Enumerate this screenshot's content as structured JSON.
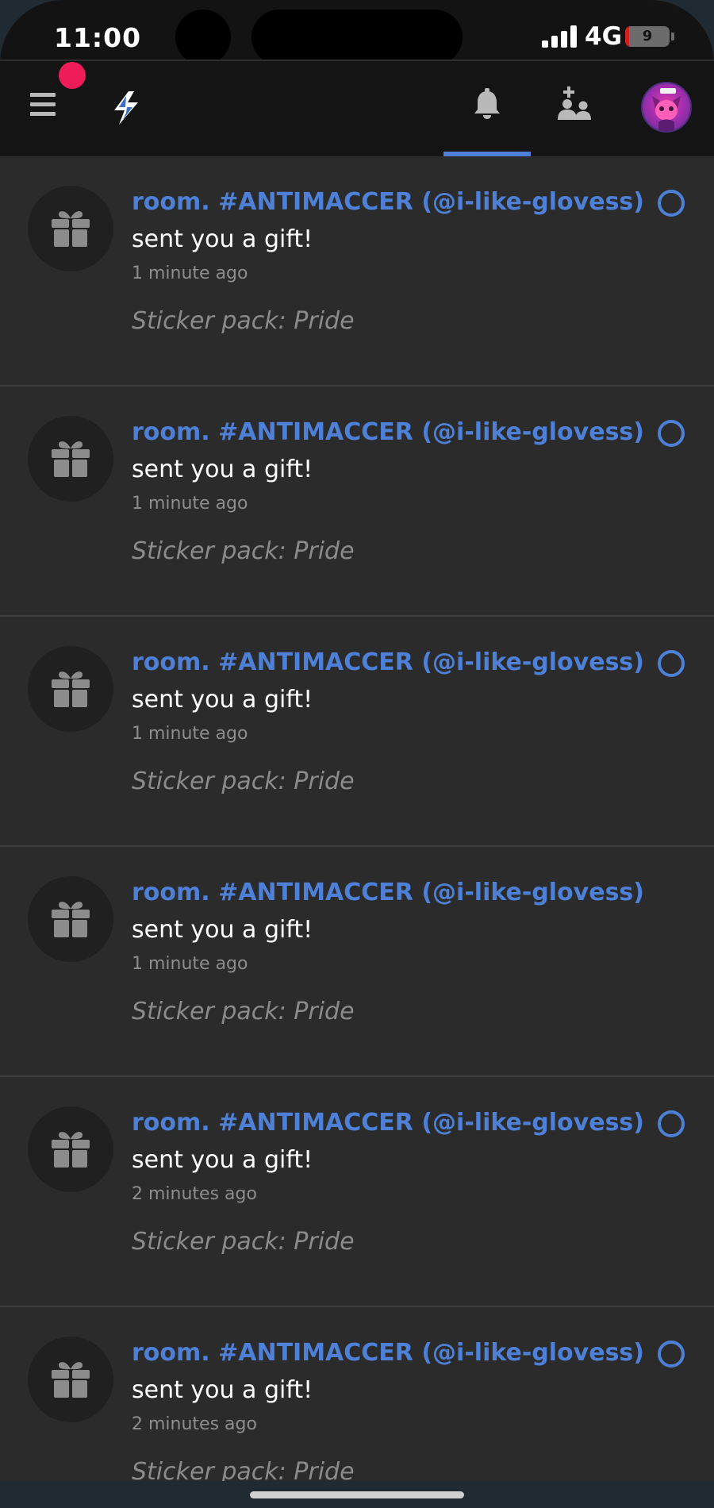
{
  "status_bar": {
    "time": "11:00",
    "network": "4G",
    "battery_level": "9",
    "battery_fraction": 0.09
  },
  "nav": {
    "menu_icon": "hamburger-menu-icon",
    "logo_icon": "lightning-bolt-logo-icon",
    "tabs": [
      {
        "icon": "bell-icon",
        "active": true
      },
      {
        "icon": "friends-icon",
        "active": false
      }
    ],
    "avatar_icon": "user-avatar",
    "notification_badge_color": "#ef1c5a"
  },
  "colors": {
    "accent": "#4d80d6",
    "background": "#2b2b2b",
    "nav_background": "#141414"
  },
  "notifications": [
    {
      "sender": "room. #ANTIMACCER (@i-like-glovess)",
      "message": "sent you a gift!",
      "time": "1 minute ago",
      "detail": "Sticker pack: Pride",
      "unread": true
    },
    {
      "sender": "room. #ANTIMACCER (@i-like-glovess)",
      "message": "sent you a gift!",
      "time": "1 minute ago",
      "detail": "Sticker pack: Pride",
      "unread": true
    },
    {
      "sender": "room. #ANTIMACCER (@i-like-glovess)",
      "message": "sent you a gift!",
      "time": "1 minute ago",
      "detail": "Sticker pack: Pride",
      "unread": true
    },
    {
      "sender": "room. #ANTIMACCER (@i-like-glovess)",
      "message": "sent you a gift!",
      "time": "1 minute ago",
      "detail": "Sticker pack: Pride",
      "unread": false
    },
    {
      "sender": "room. #ANTIMACCER (@i-like-glovess)",
      "message": "sent you a gift!",
      "time": "2 minutes ago",
      "detail": "Sticker pack: Pride",
      "unread": true
    },
    {
      "sender": "room. #ANTIMACCER (@i-like-glovess)",
      "message": "sent you a gift!",
      "time": "2 minutes ago",
      "detail": "Sticker pack: Pride",
      "unread": true
    }
  ]
}
